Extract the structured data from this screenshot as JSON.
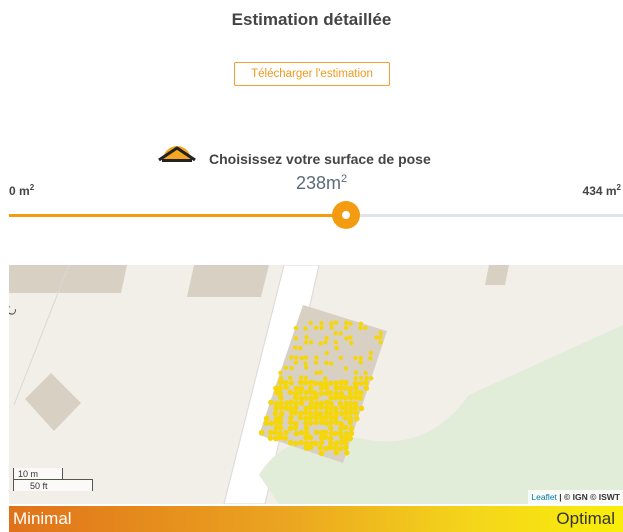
{
  "header": {
    "title": "Estimation détaillée"
  },
  "actions": {
    "download_label": "Télécharger l'estimation"
  },
  "surface": {
    "label": "Choisissez votre surface de pose",
    "icon": "roof-sun-icon",
    "min": "0 m",
    "max": "434 m",
    "current": "238m",
    "unit_exp": "2",
    "min_value": 0,
    "max_value": 434,
    "current_value": 238
  },
  "map": {
    "scale_metric": "10 m",
    "scale_imperial": "50 ft",
    "attribution_leaflet": "Leaflet",
    "attribution_rest": " | © IGN © ISWT"
  },
  "legend": {
    "min_label": "Minimal",
    "max_label": "Optimal"
  },
  "colors": {
    "accent": "#f39c12",
    "panel_dot": "#f5d60a",
    "track": "#dfe3ee"
  }
}
